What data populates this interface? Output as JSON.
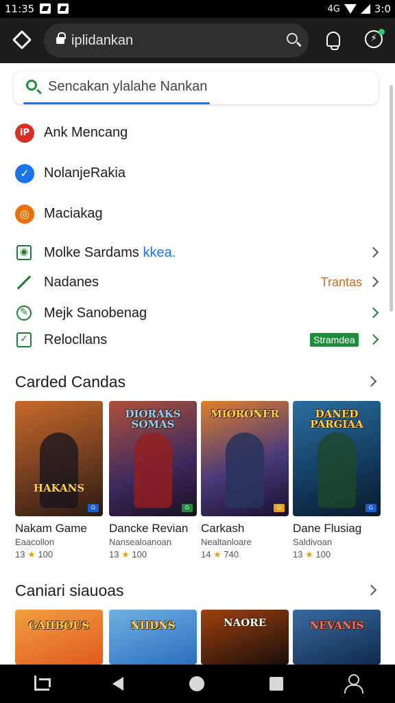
{
  "status_bar": {
    "time": "11:35",
    "right_text": "3:0",
    "network_label": "4G"
  },
  "app_bar": {
    "url_text": "iplidankan"
  },
  "search": {
    "placeholder": "Sencakan ylalahe Nankan"
  },
  "list": [
    {
      "label": "Ank Mencang",
      "icon": "app-icon",
      "glyph": "iP",
      "color": "#d93025"
    },
    {
      "label": "NolanjeRakia",
      "icon": "check-icon",
      "glyph": "✓",
      "color": "#1a73e8"
    },
    {
      "label": "Maciakag",
      "icon": "swirl-icon",
      "glyph": "◎",
      "color": "#e8710a"
    }
  ],
  "menu": [
    {
      "label": "Molke Sardams",
      "accent": "kkea.",
      "accent_color": "#1a73e8",
      "icon": "camera-icon"
    },
    {
      "label": "Nadanes",
      "trailing": "Trantas",
      "icon": "pencil-icon"
    },
    {
      "label": "Mejk Sanobenag",
      "icon": "edit-icon"
    },
    {
      "label": "Relocllans",
      "badge": "Stramdea",
      "icon": "checkbox-icon"
    }
  ],
  "sections": [
    {
      "title": "Carded Candas",
      "cards": [
        {
          "name": "Nakam Game",
          "sub": "Eaacollon",
          "rating": "13",
          "downloads": "100",
          "art_title": "HAKANS",
          "bg": "#6b3a1f",
          "bg2": "#c86a2a"
        },
        {
          "name": "Dancke Revian",
          "sub": "Nansealoanoan",
          "rating": "13",
          "downloads": "100",
          "art_title": "DIORAKS SOMAS",
          "bg": "#3a2a5e",
          "bg2": "#b0503a"
        },
        {
          "name": "Carkash",
          "sub": "Nealtanloare",
          "rating": "14",
          "downloads": "740",
          "art_title": "MIORONER",
          "bg": "#4a3a7a",
          "bg2": "#e0802a"
        },
        {
          "name": "Dane Flusiag",
          "sub": "Saldivoan",
          "rating": "13",
          "downloads": "100",
          "art_title": "DANED PARGIAA",
          "bg": "#123a5e",
          "bg2": "#2a6fa0"
        }
      ]
    },
    {
      "title": "Caniari siauoas",
      "cards": [
        {
          "art_title": "GAHBOUS",
          "bg": "#e05a1f",
          "bg2": "#f0a040"
        },
        {
          "art_title": "NIIDNS",
          "bg": "#2a6fc0",
          "bg2": "#70b0e0"
        },
        {
          "art_title": "NAORE",
          "bg": "#1a0f0a",
          "bg2": "#a04010"
        },
        {
          "art_title": "NEVANIS",
          "bg": "#0f2a4e",
          "bg2": "#3a6aa0"
        }
      ]
    }
  ]
}
